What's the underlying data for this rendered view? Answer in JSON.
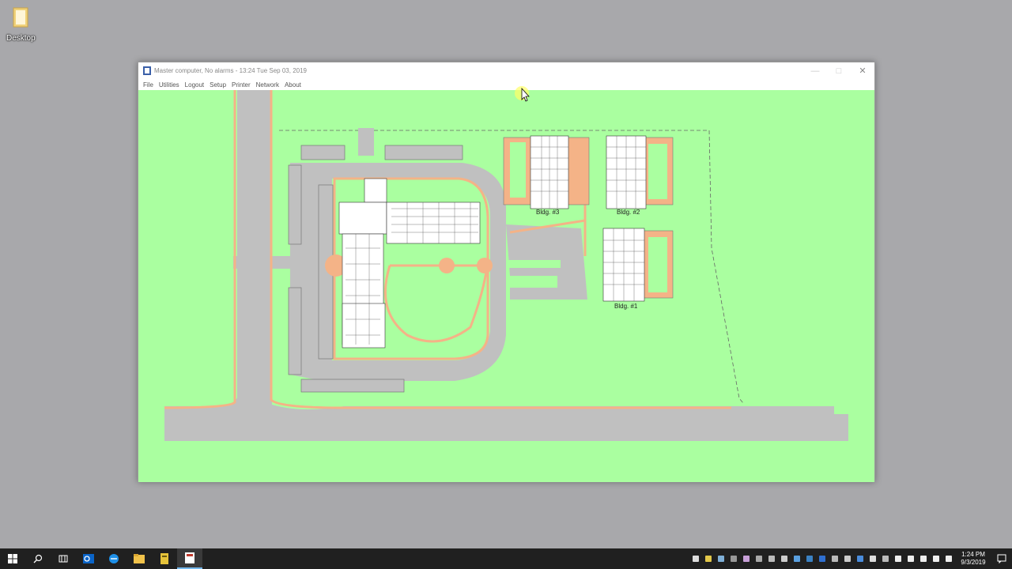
{
  "desktop": {
    "icon_label": "Desktop",
    "background": "#a8a8ab"
  },
  "window": {
    "title": "Master computer, No alarms - 13:24 Tue Sep 03, 2019",
    "controls": {
      "minimize": "—",
      "maximize": "□",
      "close": "✕"
    }
  },
  "menu": {
    "items": [
      "File",
      "Utilities",
      "Logout",
      "Setup",
      "Printer",
      "Network",
      "About"
    ]
  },
  "map": {
    "background": "#aaffa0",
    "road_color": "#c0c0c0",
    "path_color": "#f4b387",
    "buildings": [
      {
        "label": "Bldg. #3"
      },
      {
        "label": "Bldg. #2"
      },
      {
        "label": "Bldg. #1"
      }
    ]
  },
  "taskbar": {
    "clock_time": "1:24 PM",
    "clock_date": "9/3/2019",
    "apps": [
      "start-icon",
      "search-icon",
      "task-view-icon",
      "outlook-icon",
      "edge-icon",
      "file-explorer-icon",
      "app-icon",
      "master-app-icon"
    ]
  }
}
